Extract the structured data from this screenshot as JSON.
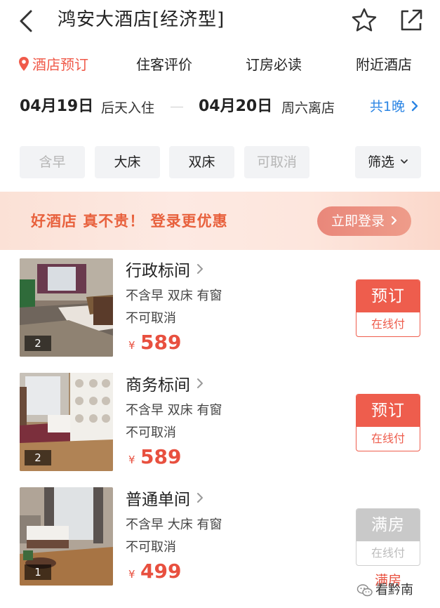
{
  "header": {
    "title": "鸿安大酒店[经济型]"
  },
  "tabs": [
    {
      "label": "酒店预订",
      "active": true
    },
    {
      "label": "住客评价",
      "active": false
    },
    {
      "label": "订房必读",
      "active": false
    },
    {
      "label": "附近酒店",
      "active": false
    }
  ],
  "dates": {
    "checkin_date": "04月19日",
    "checkin_label": "后天入住",
    "checkout_date": "04月20日",
    "checkout_label": "周六离店",
    "nights": "共1晚"
  },
  "filters": {
    "chips": [
      {
        "label": "含早",
        "disabled": true
      },
      {
        "label": "大床",
        "disabled": false
      },
      {
        "label": "双床",
        "disabled": false
      },
      {
        "label": "可取消",
        "disabled": true
      }
    ],
    "filter_label": "筛选"
  },
  "banner": {
    "text": "好酒店 真不贵！ 登录更优惠",
    "button": "立即登录"
  },
  "rooms": [
    {
      "name": "行政标间",
      "features": "不含早 双床 有窗",
      "cancel": "不可取消",
      "currency": "¥",
      "price": "589",
      "photo_count": "2",
      "book_label": "预订",
      "pay_label": "在线付",
      "full": false
    },
    {
      "name": "商务标间",
      "features": "不含早 双床 有窗",
      "cancel": "不可取消",
      "currency": "¥",
      "price": "589",
      "photo_count": "2",
      "book_label": "预订",
      "pay_label": "在线付",
      "full": false
    },
    {
      "name": "普通单间",
      "features": "不含早 大床 有窗",
      "cancel": "不可取消",
      "currency": "¥",
      "price": "499",
      "photo_count": "1",
      "book_label": "满房",
      "pay_label": "在线付",
      "full": true,
      "full_note": "满房"
    }
  ],
  "watermark": "看黔南",
  "colors": {
    "accent": "#ee5d4d",
    "link": "#2b85e4",
    "banner_text": "#e8613d",
    "disabled": "#c9c9c9"
  }
}
